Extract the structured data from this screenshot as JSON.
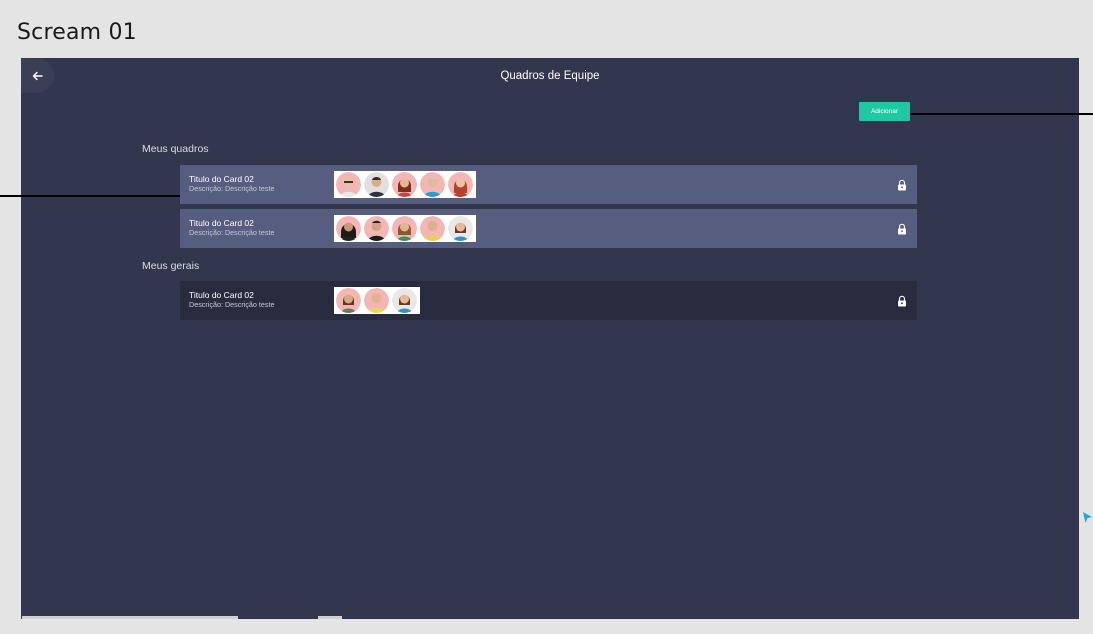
{
  "frame_label": "Scream 01",
  "header": {
    "title": "Quadros de Equipe",
    "back_icon": "arrow-left-icon"
  },
  "add_button": {
    "label": "Adicionar",
    "color": "#1dc9a3"
  },
  "sections": [
    {
      "title": "Meus quadros",
      "cards": [
        {
          "title": "Titulo do Card 02",
          "description": "Descrição: Descrição teste",
          "members": 5,
          "locked": true
        },
        {
          "title": "Titulo do Card 02",
          "description": "Descrição: Descrição teste",
          "members": 5,
          "locked": true
        }
      ]
    },
    {
      "title": "Meus gerais",
      "cards": [
        {
          "title": "Titulo do Card 02",
          "description": "Descrição: Descrição teste",
          "members": 3,
          "locked": true
        }
      ]
    }
  ],
  "colors": {
    "background": "#33374d",
    "card_primary": "#565d7e",
    "card_dark": "#282c3e",
    "accent": "#1dc9a3"
  }
}
